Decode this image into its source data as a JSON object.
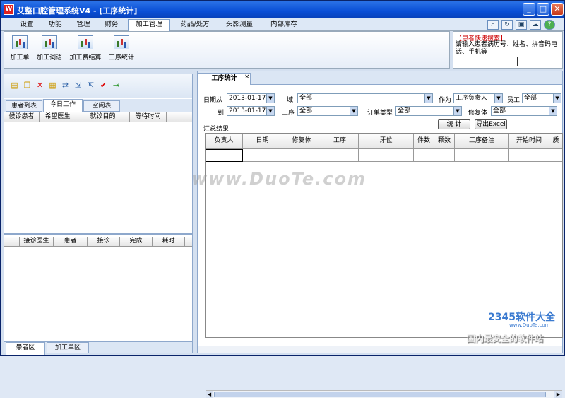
{
  "window": {
    "app_icon": "W",
    "title": "艾整口腔管理系统V4 - [工序统计]",
    "buttons": {
      "min": "_",
      "max": "□",
      "close": "✕"
    }
  },
  "menu": {
    "items": [
      "设置",
      "功能",
      "管理",
      "财务",
      "加工管理",
      "药品/处方",
      "头影测量",
      "内部库存"
    ],
    "active": "加工管理"
  },
  "toolbar_icons": [
    "search-icon",
    "cycle-icon",
    "window-icon",
    "chat-icon",
    "help-icon"
  ],
  "ribbon": {
    "buttons": [
      "加工单",
      "加工词语",
      "加工费结算",
      "工序统计"
    ]
  },
  "quick_search": {
    "title": "【患者快速搜索】",
    "desc": "请输入患者病历号、姓名、拼音码电话、手机等",
    "value": ""
  },
  "left_panel": {
    "toolbar_icons": [
      "new-icon",
      "copy-icon",
      "delete-icon",
      "edit-icon",
      "transfer-icon",
      "import-icon",
      "export-icon",
      "check-icon",
      "exit-icon"
    ],
    "tabs": [
      "患者列表",
      "今日工作",
      "空闲表"
    ],
    "active_tab": "今日工作",
    "upper_columns": [
      "候诊患者",
      "希望医生",
      "就诊目的",
      "等待时间"
    ],
    "lower_columns": [
      "接诊医生",
      "患者",
      "接诊",
      "完成",
      "耗时"
    ],
    "bottom_tabs": [
      "患者区",
      "加工单区"
    ]
  },
  "right_panel": {
    "tab": "工序统计",
    "tab_close": "×",
    "form": {
      "date_from_label": "日期从",
      "date_from": "2013-01-17",
      "date_to_label": "到",
      "date_to": "2013-01-17",
      "domain_label": "域",
      "domain": "全部",
      "process_label": "工序",
      "process": "全部",
      "role_label": "作为",
      "role": "工序负责人",
      "staff_label": "员工",
      "staff": "全部",
      "order_type_label": "订单类型",
      "order_type": "全部",
      "restoration_label": "修复体",
      "restoration": "全部"
    },
    "summary_label": "汇总结果",
    "stat_button": "统 计",
    "export_button": "导出Excel",
    "columns": [
      "负责人",
      "日期",
      "修复体",
      "工序",
      "牙位",
      "件数",
      "颗数",
      "工序备注",
      "开始时间",
      "质"
    ]
  },
  "watermark": "www.DuoTe.com",
  "footer_logo": {
    "brand": "2345软件大全",
    "url": "www.DuoTe.com",
    "slogan": "国内最安全的软件站"
  }
}
